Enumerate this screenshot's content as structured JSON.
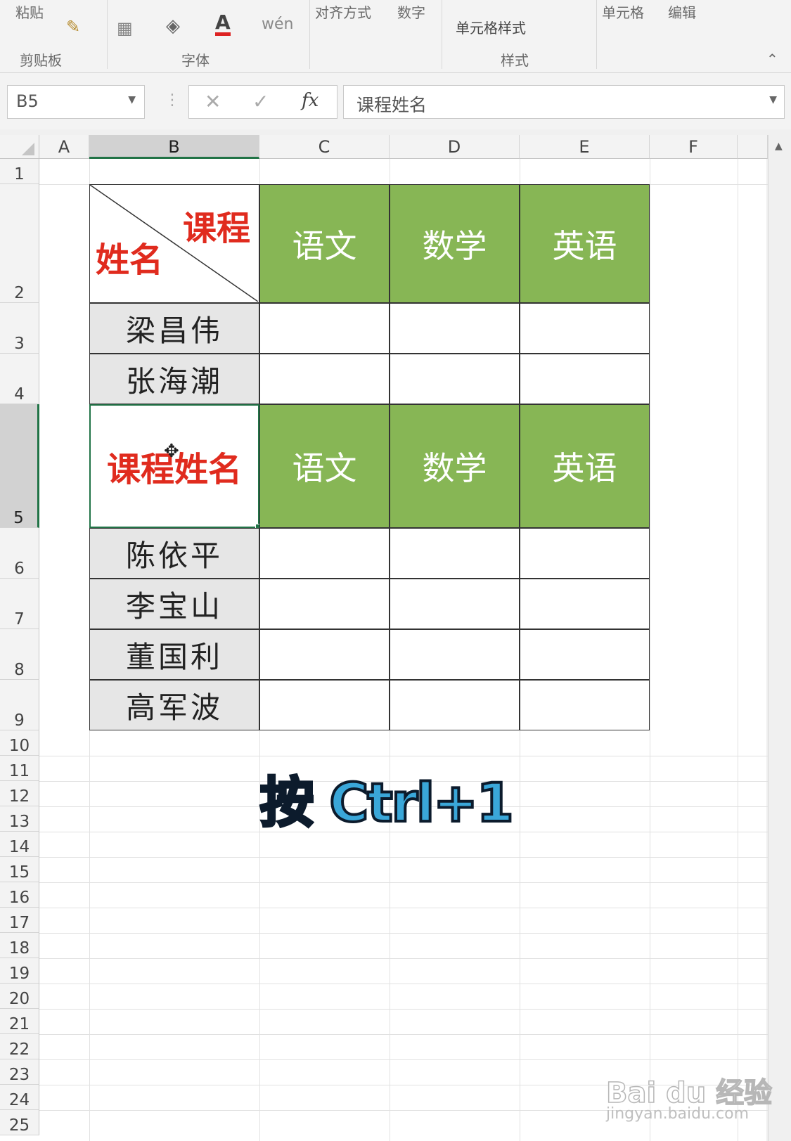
{
  "ribbon": {
    "clipboard_top": "粘贴",
    "clipboard_group": "剪贴板",
    "font_group": "字体",
    "align": "对齐方式",
    "number": "数字",
    "cell_style": "单元格样式",
    "style_group": "样式",
    "cells": "单元格",
    "edit": "编辑",
    "font_color_letter": "A",
    "wen_glyph": "wén"
  },
  "formula_bar": {
    "name_box": "B5",
    "fx": "fx",
    "formula": "课程姓名"
  },
  "columns": [
    "A",
    "B",
    "C",
    "D",
    "E",
    "F"
  ],
  "rows": [
    "1",
    "2",
    "3",
    "4",
    "5",
    "6",
    "7",
    "8",
    "9",
    "10",
    "11",
    "12",
    "13",
    "14",
    "15",
    "16",
    "17",
    "18",
    "19",
    "20",
    "21",
    "22",
    "23",
    "24",
    "25"
  ],
  "table": {
    "header1_top": "课程",
    "header1_bottom": "姓名",
    "header2": "课程姓名",
    "subjects": [
      "语文",
      "数学",
      "英语"
    ],
    "names_group1": [
      "梁昌伟",
      "张海潮"
    ],
    "names_group2": [
      "陈依平",
      "李宝山",
      "董国利",
      "高军波"
    ]
  },
  "overlay_caption": "按 Ctrl+1",
  "watermark": {
    "logo": "Bai du 经验",
    "url": "jingyan.baidu.com"
  },
  "colors": {
    "green_header": "#87b655",
    "red_text": "#e02b1e",
    "caption_blue": "#3aa7d9"
  }
}
